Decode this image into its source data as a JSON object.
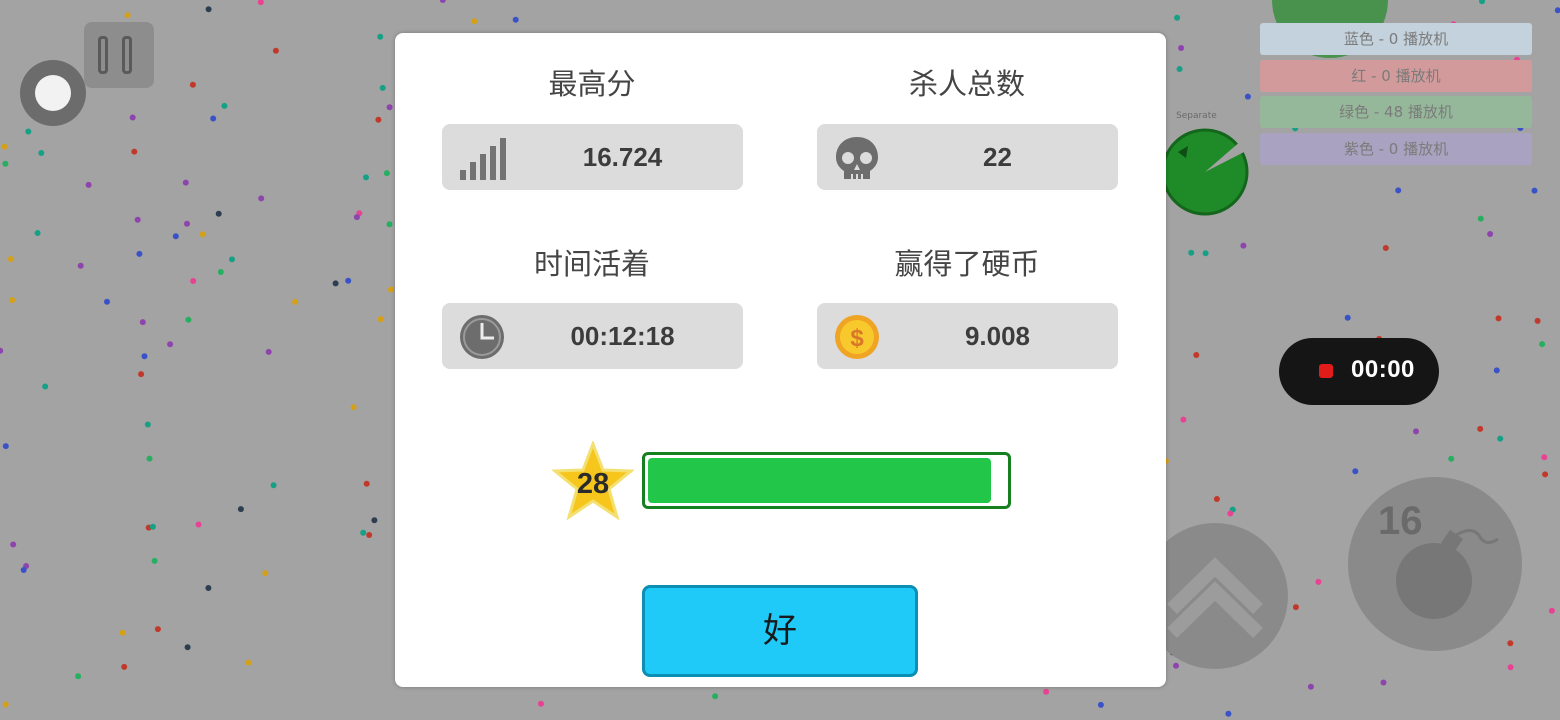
{
  "controls": {
    "joystick_icon": "joystick-icon",
    "pause_icon": "pause-icon"
  },
  "leaderboard": [
    {
      "label": "蓝色 - 0 播放机",
      "color": "#c3d2dc"
    },
    {
      "label": "红 - 0 播放机",
      "color": "#d29a9a"
    },
    {
      "label": "绿色 - 48 播放机",
      "color": "#96b89a"
    },
    {
      "label": "紫色 - 0 播放机",
      "color": "#a9a2c0"
    }
  ],
  "player": {
    "name": "Separate",
    "color": "#1e8a28"
  },
  "recording": {
    "time": "00:00",
    "dot_color": "#e21b1b"
  },
  "actions": {
    "split_icon": "chevron-up-icon",
    "bomb_icon": "bomb-icon",
    "bomb_count": "16"
  },
  "dialog": {
    "stats": [
      {
        "title": "最高分",
        "value": "16.724",
        "icon": "signal-bars-icon"
      },
      {
        "title": "杀人总数",
        "value": "22",
        "icon": "skull-icon"
      },
      {
        "title": "时间活着",
        "value": "00:12:18",
        "icon": "clock-icon"
      },
      {
        "title": "赢得了硬币",
        "value": "9.008",
        "icon": "coin-icon"
      }
    ],
    "level": "28",
    "xp_progress": 0.96,
    "ok_label": "好"
  },
  "colors": {
    "ok_button": "#1fc9f8",
    "xp_fill": "#22c74a",
    "star": "#f7c61c"
  }
}
